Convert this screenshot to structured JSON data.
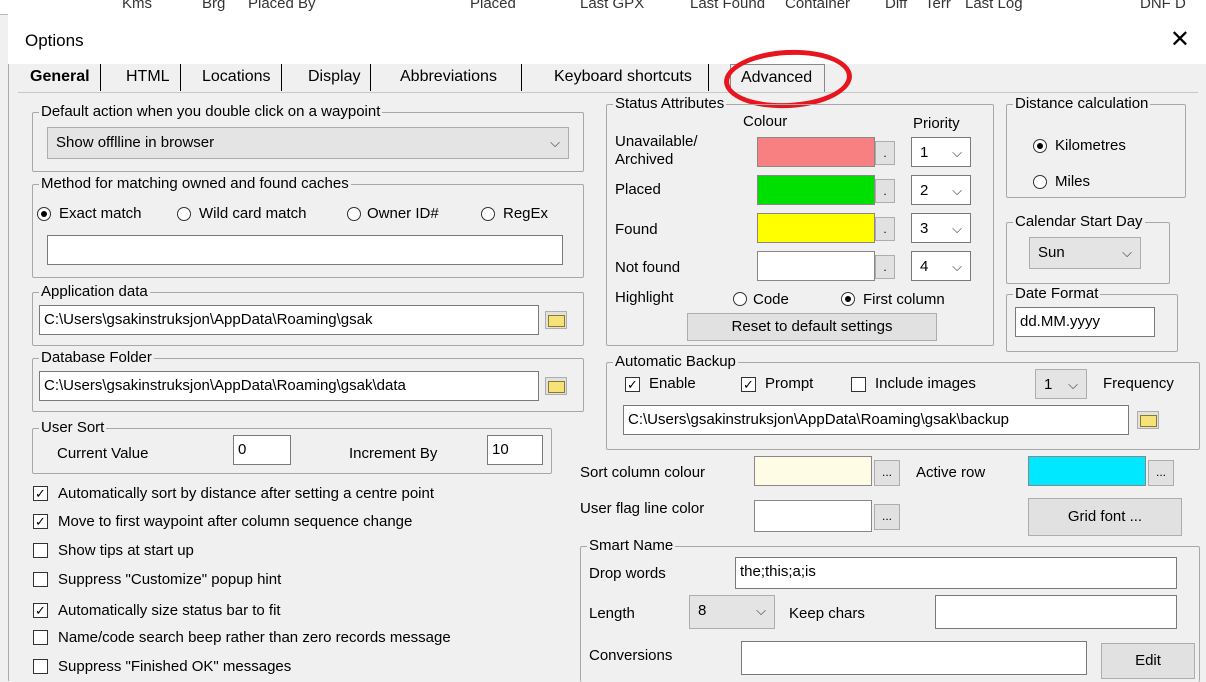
{
  "background_columns": [
    "Kms",
    "Brg",
    "Placed By",
    "Placed",
    "Last GPX",
    "Last Found",
    "Container",
    "Diff",
    "Terr",
    "Last Log",
    "DNF D"
  ],
  "window": {
    "title": "Options",
    "close_glyph": "✕"
  },
  "tabs": [
    {
      "label": "General",
      "active": true
    },
    {
      "label": "HTML"
    },
    {
      "label": "Locations"
    },
    {
      "label": "Display"
    },
    {
      "label": "Abbreviations"
    },
    {
      "label": "Keyboard shortcuts"
    },
    {
      "label": "Advanced"
    }
  ],
  "double_click": {
    "legend": "Default action when you double click on a waypoint",
    "value": "Show offlline in browser"
  },
  "matching": {
    "legend": "Method for matching owned and found caches",
    "options": [
      "Exact match",
      "Wild card match",
      "Owner ID#",
      "RegEx"
    ],
    "selected": "Exact match",
    "value": ""
  },
  "app_data": {
    "legend": "Application data",
    "path": "C:\\Users\\gsakinstruksjon\\AppData\\Roaming\\gsak"
  },
  "db_folder": {
    "legend": "Database Folder",
    "path": "C:\\Users\\gsakinstruksjon\\AppData\\Roaming\\gsak\\data"
  },
  "user_sort": {
    "legend": "User Sort",
    "current_label": "Current Value",
    "current_value": "0",
    "increment_label": "Increment By",
    "increment_value": "10"
  },
  "checkboxes": [
    {
      "label": "Automatically sort by distance after setting a centre point",
      "checked": true
    },
    {
      "label": "Move to first waypoint after column sequence change",
      "checked": true
    },
    {
      "label": "Show tips at start up",
      "checked": false
    },
    {
      "label": "Suppress \"Customize\" popup hint",
      "checked": false
    },
    {
      "label": "Automatically size status bar to fit",
      "checked": true
    },
    {
      "label": "Name/code search beep rather than zero records message",
      "checked": false
    },
    {
      "label": "Suppress \"Finished OK\" messages",
      "checked": false
    }
  ],
  "status": {
    "legend": "Status Attributes",
    "colour_header": "Colour",
    "priority_header": "Priority",
    "rows": [
      {
        "label": "Unavailable/\nArchived",
        "color": "#f88080",
        "priority": "1"
      },
      {
        "label": "Placed",
        "color": "#00e000",
        "priority": "2"
      },
      {
        "label": "Found",
        "color": "#ffff00",
        "priority": "3"
      },
      {
        "label": "Not found",
        "color": "#ffffff",
        "priority": "4"
      }
    ],
    "highlight_label": "Highlight",
    "highlight_options": [
      "Code",
      "First column"
    ],
    "highlight_selected": "First column",
    "reset_label": "Reset to default settings",
    "dots": "."
  },
  "distance": {
    "legend": "Distance calculation",
    "options": [
      "Kilometres",
      "Miles"
    ],
    "selected": "Kilometres"
  },
  "calendar": {
    "legend": "Calendar Start Day",
    "value": "Sun"
  },
  "date_format": {
    "legend": "Date Format",
    "value": "dd.MM.yyyy"
  },
  "backup": {
    "legend": "Automatic Backup",
    "enable_label": "Enable",
    "enable": true,
    "prompt_label": "Prompt",
    "prompt": true,
    "images_label": "Include images",
    "images": false,
    "frequency_value": "1",
    "frequency_label": "Frequency",
    "path": "C:\\Users\\gsakinstruksjon\\AppData\\Roaming\\gsak\\backup"
  },
  "colours": {
    "sort_label": "Sort column colour",
    "sort_color": "#fffce6",
    "active_label": "Active row",
    "active_color": "#00e8ff",
    "userflag_label": "User flag line color",
    "userflag_color": "#ffffff",
    "dots": "...",
    "grid_font_label": "Grid font ..."
  },
  "smart_name": {
    "legend": "Smart Name",
    "drop_label": "Drop words",
    "drop_value": "the;this;a;is",
    "length_label": "Length",
    "length_value": "8",
    "keep_label": "Keep chars",
    "keep_value": "",
    "conv_label": "Conversions",
    "conv_value": "",
    "edit_label": "Edit"
  },
  "arrow_glyph": "⌵",
  "check_glyph": "✓",
  "accent_circle_color": "#e8141e"
}
